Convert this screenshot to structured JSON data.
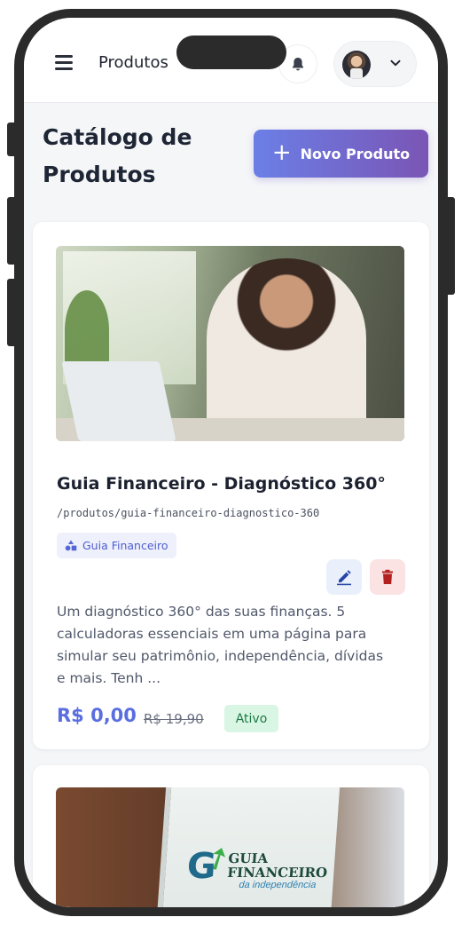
{
  "header": {
    "title": "Produtos",
    "menu_icon": "hamburger-icon",
    "notification_icon": "bell-icon",
    "user_menu_icon": "chevron-down-icon"
  },
  "page": {
    "title": "Catálogo de Produtos",
    "new_button_label": "Novo Produto",
    "new_button_icon": "plus-icon"
  },
  "colors": {
    "accent_start": "#6b7fe6",
    "accent_end": "#7a55b5",
    "price": "#5a6ee0",
    "status_active_bg": "#d9f6e4",
    "status_active_text": "#1e7a44",
    "delete_bg": "#fbe3e3",
    "delete_icon": "#b32020",
    "edit_bg": "#eaf0fb",
    "edit_icon": "#2945a8"
  },
  "products": [
    {
      "name": "Guia Financeiro - Diagnóstico 360°",
      "slug": "/produtos/guia-financeiro-diagnostico-360",
      "category": "Guia Financeiro",
      "category_icon": "shapes-icon",
      "description": "Um diagnóstico 360° das suas finanças. 5 calculadoras essenciais em uma página para simular seu patrimônio, independência, dívidas e mais. Tenh ...",
      "price": "R$ 0,00",
      "old_price": "R$ 19,90",
      "status": "Ativo",
      "edit_icon": "pencil-icon",
      "delete_icon": "trash-icon"
    },
    {
      "cover_title_line1": "GUIA",
      "cover_title_line2": "FINANCEIRO",
      "cover_subtitle": "da independência",
      "cover_logo": "G"
    }
  ]
}
